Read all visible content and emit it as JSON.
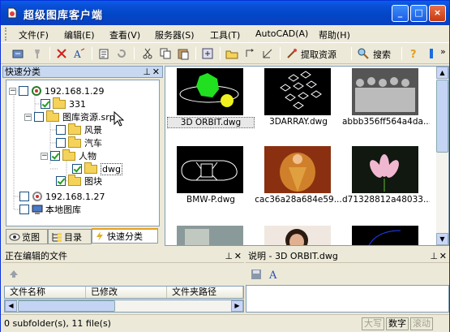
{
  "window": {
    "title": "超级图库客户端",
    "buttons": {
      "minimize": "_",
      "maximize": "□",
      "close": "×"
    }
  },
  "menu": [
    "文件(F)",
    "编辑(E)",
    "查看(V)",
    "服务器(S)",
    "工具(T)",
    "AutoCAD(A)",
    "帮助(H)"
  ],
  "toolbar": {
    "extract_label": "提取资源",
    "search_label": "搜索"
  },
  "left_panel": {
    "title": "快速分类",
    "tree": [
      {
        "label": "192.168.1.29",
        "checked": false
      },
      {
        "label": "331",
        "checked": true
      },
      {
        "label": "图库资源.srp",
        "checked": false
      },
      {
        "label": "风景",
        "checked": false
      },
      {
        "label": "汽车",
        "checked": false
      },
      {
        "label": "人物",
        "checked": true
      },
      {
        "label": "dwg",
        "checked": true
      },
      {
        "label": "图块",
        "checked": true
      },
      {
        "label": "192.168.1.27",
        "checked": false
      },
      {
        "label": "本地图库",
        "checked": false
      }
    ],
    "tabs": [
      "览图",
      "目录",
      "快速分类"
    ]
  },
  "thumbnails": [
    {
      "name": "3D ORBIT.dwg",
      "selected": true
    },
    {
      "name": "3DARRAY.dwg"
    },
    {
      "name": "abbb356ff564a4da..."
    },
    {
      "name": "BMW-P.dwg"
    },
    {
      "name": "cac36a28a684e59..."
    },
    {
      "name": "d71328812a48033..."
    }
  ],
  "editing_panel": {
    "title": "正在编辑的文件",
    "columns": [
      "文件名称",
      "已修改",
      "文件夹路径"
    ]
  },
  "desc_panel": {
    "title": "说明 - 3D ORBIT.dwg"
  },
  "status": {
    "text": "0 subfolder(s), 11 file(s)",
    "keys": [
      "大写",
      "数字",
      "滚动"
    ]
  },
  "colors": {
    "title_bar": "#0a4fd8",
    "tree_check": "#21a121",
    "selected_thumb": "#e8e8e8"
  }
}
